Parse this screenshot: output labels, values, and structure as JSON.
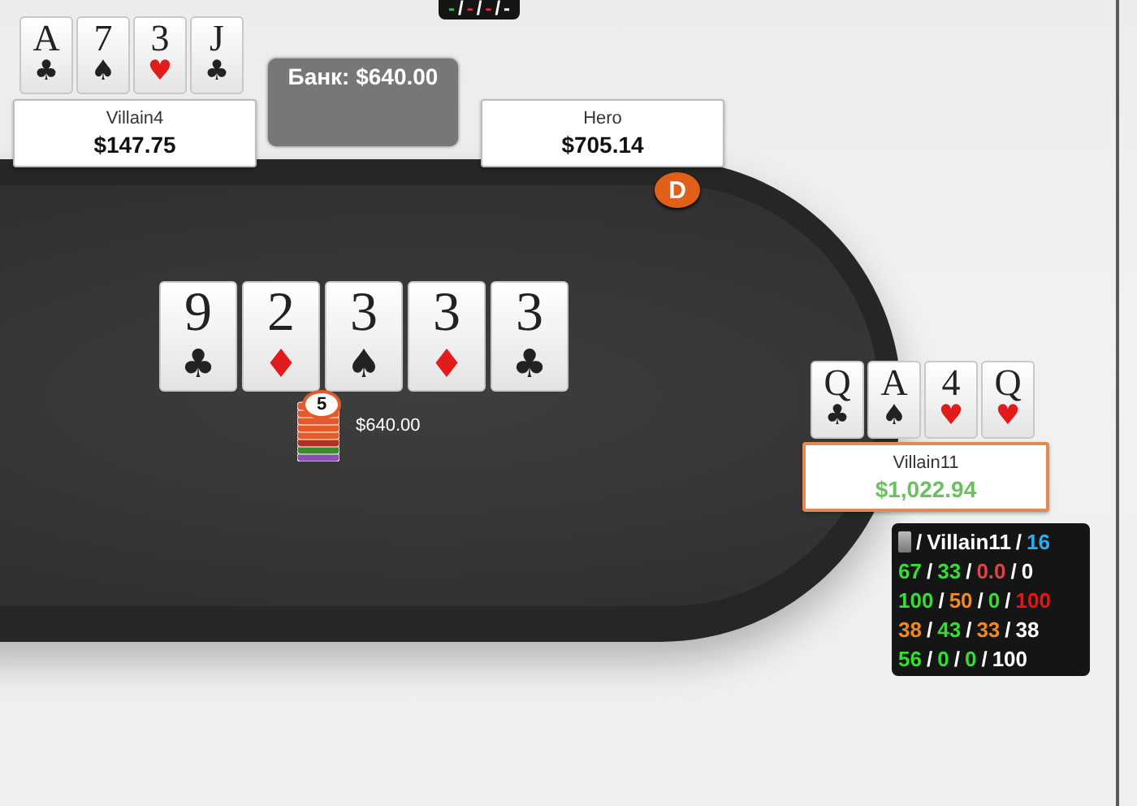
{
  "top_hud": {
    "separator": "/",
    "stats": [
      {
        "text": "-",
        "color": "#33cc33"
      },
      {
        "text": "-",
        "color": "#dd3333"
      },
      {
        "text": "-",
        "color": "#dd3333"
      },
      {
        "text": "-",
        "color": "#ffffff"
      }
    ]
  },
  "pot": {
    "label": "Банк: $640.00"
  },
  "seats": [
    {
      "name": "Villain4",
      "stack": "$147.75",
      "active": false,
      "dealer": false,
      "cards": [
        {
          "rank": "A",
          "suit": "♣",
          "color": "#222222"
        },
        {
          "rank": "7",
          "suit": "♠",
          "color": "#222222"
        },
        {
          "rank": "3",
          "suit": "♥",
          "color": "#e21b1b"
        },
        {
          "rank": "J",
          "suit": "♣",
          "color": "#222222"
        }
      ]
    },
    {
      "name": "Hero",
      "stack": "$705.14",
      "active": false,
      "dealer": true,
      "dealer_label": "D"
    },
    {
      "name": "Villain11",
      "stack": "$1,022.94",
      "active": true,
      "dealer": false,
      "cards": [
        {
          "rank": "Q",
          "suit": "♣",
          "color": "#222222"
        },
        {
          "rank": "A",
          "suit": "♠",
          "color": "#222222"
        },
        {
          "rank": "4",
          "suit": "♥",
          "color": "#e21b1b"
        },
        {
          "rank": "Q",
          "suit": "♥",
          "color": "#e21b1b"
        }
      ]
    }
  ],
  "board": [
    {
      "rank": "9",
      "suit": "♣",
      "color": "#222222"
    },
    {
      "rank": "2",
      "suit": "♦",
      "color": "#e21b1b"
    },
    {
      "rank": "3",
      "suit": "♠",
      "color": "#222222"
    },
    {
      "rank": "3",
      "suit": "♦",
      "color": "#e21b1b"
    },
    {
      "rank": "3",
      "suit": "♣",
      "color": "#222222"
    }
  ],
  "bet": {
    "chip_label": "5",
    "amount": "$640.00"
  },
  "hud": {
    "separator": "/",
    "player": "Villain11",
    "rows": [
      [
        {
          "text": "16",
          "color": "#33aaee"
        }
      ],
      [
        {
          "text": "67",
          "color": "#33dd33"
        },
        {
          "text": "33",
          "color": "#33dd33"
        },
        {
          "text": "0.0",
          "color": "#dd4444"
        },
        {
          "text": "0",
          "color": "#ffffff"
        }
      ],
      [
        {
          "text": "100",
          "color": "#33dd33"
        },
        {
          "text": "50",
          "color": "#ee8822"
        },
        {
          "text": "0",
          "color": "#33dd33"
        },
        {
          "text": "100",
          "color": "#ee1111"
        }
      ],
      [
        {
          "text": "38",
          "color": "#ee8822"
        },
        {
          "text": "43",
          "color": "#33dd33"
        },
        {
          "text": "33",
          "color": "#ee8822"
        },
        {
          "text": "38",
          "color": "#ffffff"
        }
      ],
      [
        {
          "text": "56",
          "color": "#33dd33"
        },
        {
          "text": "0",
          "color": "#33dd33"
        },
        {
          "text": "0",
          "color": "#33dd33"
        },
        {
          "text": "100",
          "color": "#ffffff"
        }
      ]
    ]
  }
}
